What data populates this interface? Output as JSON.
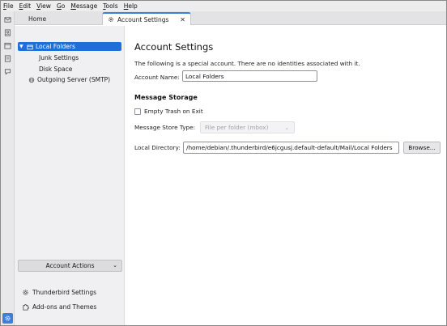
{
  "menubar": [
    {
      "key": "F",
      "rest": "ile"
    },
    {
      "key": "E",
      "rest": "dit"
    },
    {
      "key": "V",
      "rest": "iew"
    },
    {
      "key": "G",
      "rest": "o"
    },
    {
      "key": "M",
      "rest": "essage"
    },
    {
      "key": "T",
      "rest": "ools"
    },
    {
      "key": "H",
      "rest": "elp"
    }
  ],
  "tabs": {
    "home": "Home",
    "settings": "Account Settings",
    "close_glyph": "✕"
  },
  "sidebar": {
    "account": "Local Folders",
    "items": [
      "Junk Settings",
      "Disk Space"
    ],
    "outgoing": "Outgoing Server (SMTP)",
    "account_actions": "Account Actions",
    "footer": {
      "settings": "Thunderbird Settings",
      "addons": "Add-ons and Themes"
    }
  },
  "main": {
    "title": "Account Settings",
    "description": "The following is a special account. There are no identities associated with it.",
    "account_name_label": "Account Name:",
    "account_name_value": "Local Folders",
    "storage_heading": "Message Storage",
    "empty_trash_label": "Empty Trash on Exit",
    "empty_trash_checked": false,
    "store_type_label": "Message Store Type:",
    "store_type_value": "File per folder (mbox)",
    "local_dir_label": "Local Directory:",
    "local_dir_value": "/home/debian/.thunderbird/e6jcgusj.default-default/Mail/Local Folders",
    "browse_label": "Browse..."
  },
  "colors": {
    "accent": "#1f6fd9",
    "sidebar_bg": "#f0f0f3",
    "tabbar_bg": "#e3e3e6"
  }
}
